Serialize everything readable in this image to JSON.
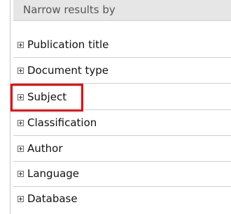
{
  "panel": {
    "header": "Narrow results by",
    "facets": [
      {
        "label": "Publication title",
        "icon": "expand-plus-icon"
      },
      {
        "label": "Document type",
        "icon": "expand-plus-icon"
      },
      {
        "label": "Subject",
        "icon": "expand-plus-icon"
      },
      {
        "label": "Classification",
        "icon": "expand-plus-icon"
      },
      {
        "label": "Author",
        "icon": "expand-plus-icon"
      },
      {
        "label": "Language",
        "icon": "expand-plus-icon"
      },
      {
        "label": "Database",
        "icon": "expand-plus-icon"
      }
    ],
    "highlighted_facet": "Subject"
  },
  "colors": {
    "header_bg": "#e6e6e6",
    "highlight": "#e8000b",
    "divider": "#cfcfcf"
  }
}
